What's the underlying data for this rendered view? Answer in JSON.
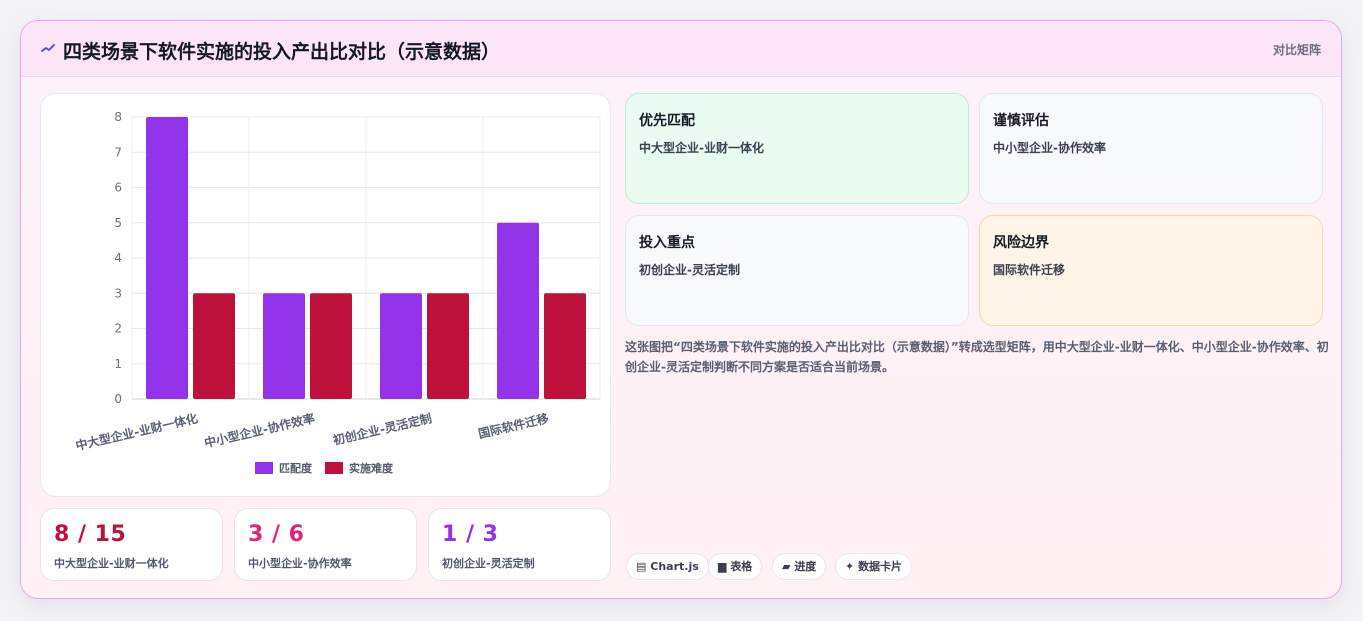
{
  "header": {
    "icon": "chart-wave-icon",
    "title": "四类场景下软件实施的投入产出比对比（示意数据）",
    "badge": "对比矩阵"
  },
  "chart_data": {
    "type": "bar",
    "categories": [
      "中大型企业-业财一体化",
      "中小型企业-协作效率",
      "初创企业-灵活定制",
      "国际软件迁移"
    ],
    "series": [
      {
        "name": "匹配度",
        "values": [
          8,
          3,
          3,
          5
        ],
        "color": "#9333ea"
      },
      {
        "name": "实施难度",
        "values": [
          3,
          3,
          3,
          3
        ],
        "color": "#be123c"
      }
    ],
    "y_ticks": [
      "0",
      "1",
      "2",
      "3",
      "4",
      "5",
      "6",
      "7",
      "8"
    ],
    "ylim": [
      0,
      8
    ],
    "grid": true,
    "legend": "bottom"
  },
  "stats": [
    {
      "value": "8 / 15",
      "label": "中大型企业-业财一体化",
      "color": "#be123c"
    },
    {
      "value": "3 / 6",
      "label": "中小型企业-协作效率",
      "color": "#db2777"
    },
    {
      "value": "1 / 3",
      "label": "初创企业-灵活定制",
      "color": "#9333ea"
    }
  ],
  "tiles": [
    {
      "title": "优先匹配",
      "text": "中大型企业-业财一体化"
    },
    {
      "title": "谨慎评估",
      "text": "中小型企业-协作效率"
    },
    {
      "title": "投入重点",
      "text": "初创企业-灵活定制"
    },
    {
      "title": "风险边界",
      "text": "国际软件迁移"
    }
  ],
  "description": "这张图把“四类场景下软件实施的投入产出比对比（示意数据）”转成选型矩阵，用中大型企业-业财一体化、中小型企业-协作效率、初创企业-灵活定制判断不同方案是否适合当前场景。",
  "tags": [
    {
      "icon": "chart-icon",
      "glyph": "▤",
      "label": "Chart.js"
    },
    {
      "icon": "table-icon",
      "glyph": "▆",
      "label": "表格"
    },
    {
      "icon": "progress-icon",
      "glyph": "▰",
      "label": "进度"
    },
    {
      "icon": "sparkle-icon",
      "glyph": "✦",
      "label": "数据卡片"
    }
  ]
}
